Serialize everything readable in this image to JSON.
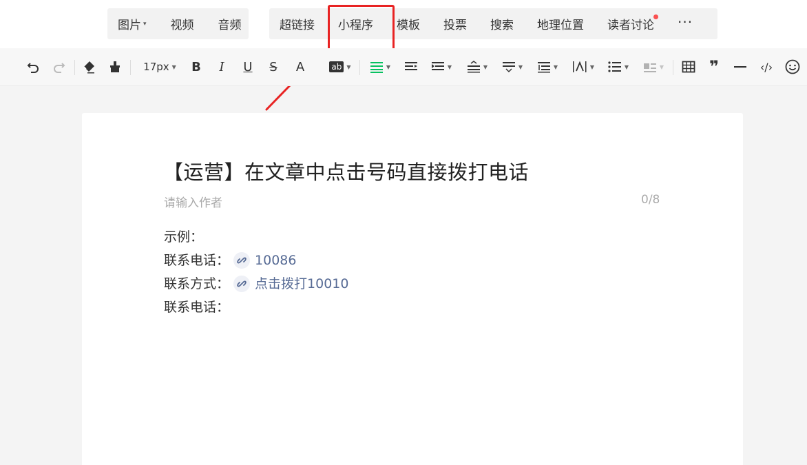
{
  "toolbar_top": {
    "media": [
      {
        "label": "图片",
        "has_dropdown": true
      },
      {
        "label": "视频"
      },
      {
        "label": "音频"
      }
    ],
    "insert": [
      {
        "label": "超链接"
      },
      {
        "label": "小程序"
      },
      {
        "label": "模板"
      },
      {
        "label": "投票"
      },
      {
        "label": "搜索"
      },
      {
        "label": "地理位置"
      },
      {
        "label": "读者讨论"
      }
    ],
    "more": "···"
  },
  "format_toolbar": {
    "font_size": "17px",
    "bold": "B",
    "italic": "I",
    "underline": "U",
    "strikethrough": "S",
    "font_color": "A",
    "highlight": "ab",
    "quote": "❞",
    "code": "‹/›"
  },
  "editor": {
    "title": "【运营】在文章中点击号码直接拨打电话",
    "author_placeholder": "请输入作者",
    "author_counter": "0/8",
    "lines": [
      {
        "text": "示例："
      },
      {
        "text": "联系电话：",
        "link": "10086"
      },
      {
        "text": "联系方式：",
        "link": "点击拨打10010"
      },
      {
        "text": "联系电话："
      }
    ]
  },
  "colors": {
    "highlight_border": "#e82323",
    "link": "#576b95",
    "align_active": "#07c160",
    "notification_dot": "#fa5151"
  }
}
